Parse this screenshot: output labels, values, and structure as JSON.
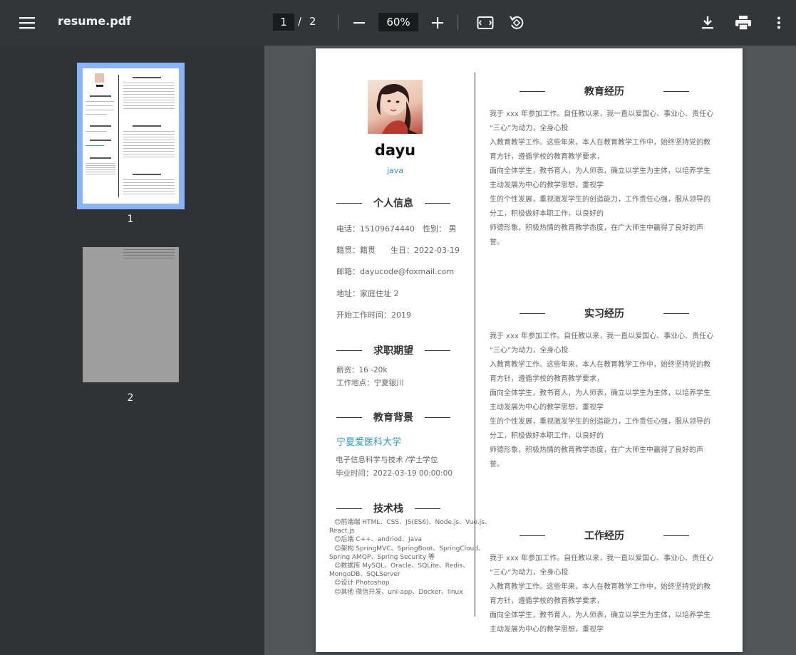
{
  "toolbar": {
    "title": "resume.pdf",
    "current_page": "1",
    "separator": "/",
    "total_pages": "2",
    "zoom": "60%"
  },
  "sidebar": {
    "thumbnails": [
      {
        "label": "1",
        "selected": true
      },
      {
        "label": "2",
        "selected": false
      }
    ]
  },
  "resume": {
    "name": "dayu",
    "job": "java",
    "personal": {
      "heading": "个人信息",
      "phone": "电话：15109674440",
      "gender": "性别：  男",
      "native": "籍贯：籍贯",
      "birthday": "生日：2022-03-19",
      "email": "邮箱：dayucode@foxmail.com",
      "address": "地址：家庭住址 2",
      "work_start": "开始工作时间：2019"
    },
    "expect": {
      "heading": "求职期望",
      "salary": "薪资：16 -20k",
      "location": "工作地点：宁夏银川"
    },
    "education": {
      "heading": "教育背景",
      "school": "宁夏爱医科大学",
      "major": "电子信息科学与技术  /学士学位",
      "graduate": "毕业时间：2022-03-19 00:00:00"
    },
    "tech": {
      "heading": "技术栈",
      "lines": [
        "😊前端端 HTML、CSS、JS(ES6)、Node.js、Vue.js、",
        "React.js",
        "😊后端 C++、andriod、Java",
        "😊架构 SpringMVC、SpringBoot、SpringCloud、",
        "Spring AMQP、Spring Security 等",
        "😊数据库 MySQL、Oracle、SQLite、Redis、",
        "MongoDB、SQLServer",
        "😊设计 Photoshop",
        "😊其他 微信开发、uni-app、Docker、linux"
      ]
    },
    "sections": [
      {
        "heading": "教育经历",
        "lines": [
          "我于 xxx 年参加工作。自任教以来，我一直以爱国心、事业心、责任心",
          "“三心”为动力，全身心投",
          "入教育教学工作。这些年来，本人在教育教学工作中，始终坚持党的教",
          "育方针，遵循学校的教育教学要求，",
          "面向全体学生，教书育人，为人师表，确立以学生为主体，以培养学生",
          "主动发展为中心的教学思想，重视学",
          "生的个性发展，重视激发学生的创造能力，工作责任心强，服从领导的",
          "分工，积极做好本职工作，以良好的",
          "师德形象，积极热情的教育教学态度，在广大师生中赢得了良好的声",
          "誉。"
        ]
      },
      {
        "heading": "实习经历",
        "lines": [
          "我于 xxx 年参加工作。自任教以来，我一直以爱国心、事业心、责任心",
          "“三心”为动力，全身心投",
          "入教育教学工作。这些年来，本人在教育教学工作中，始终坚持党的教",
          "育方针，遵循学校的教育教学要求，",
          "面向全体学生，教书育人，为人师表，确立以学生为主体，以培养学生",
          "主动发展为中心的教学思想，重视学",
          "生的个性发展，重视激发学生的创造能力，工作责任心强，服从领导的",
          "分工，积极做好本职工作，以良好的",
          "师德形象，积极热情的教育教学态度，在广大师生中赢得了良好的声",
          "誉。"
        ]
      },
      {
        "heading": "工作经历",
        "lines": [
          "我于 xxx 年参加工作。自任教以来，我一直以爱国心、事业心、责任心",
          "“三心”为动力，全身心投",
          "入教育教学工作。这些年来，本人在教育教学工作中，始终坚持党的教",
          "育方针，遵循学校的教育教学要求，",
          "面向全体学生，教书育人，为人师表，确立以学生为主体，以培养学生",
          "主动发展为中心的教学思想，重视学"
        ]
      }
    ]
  }
}
